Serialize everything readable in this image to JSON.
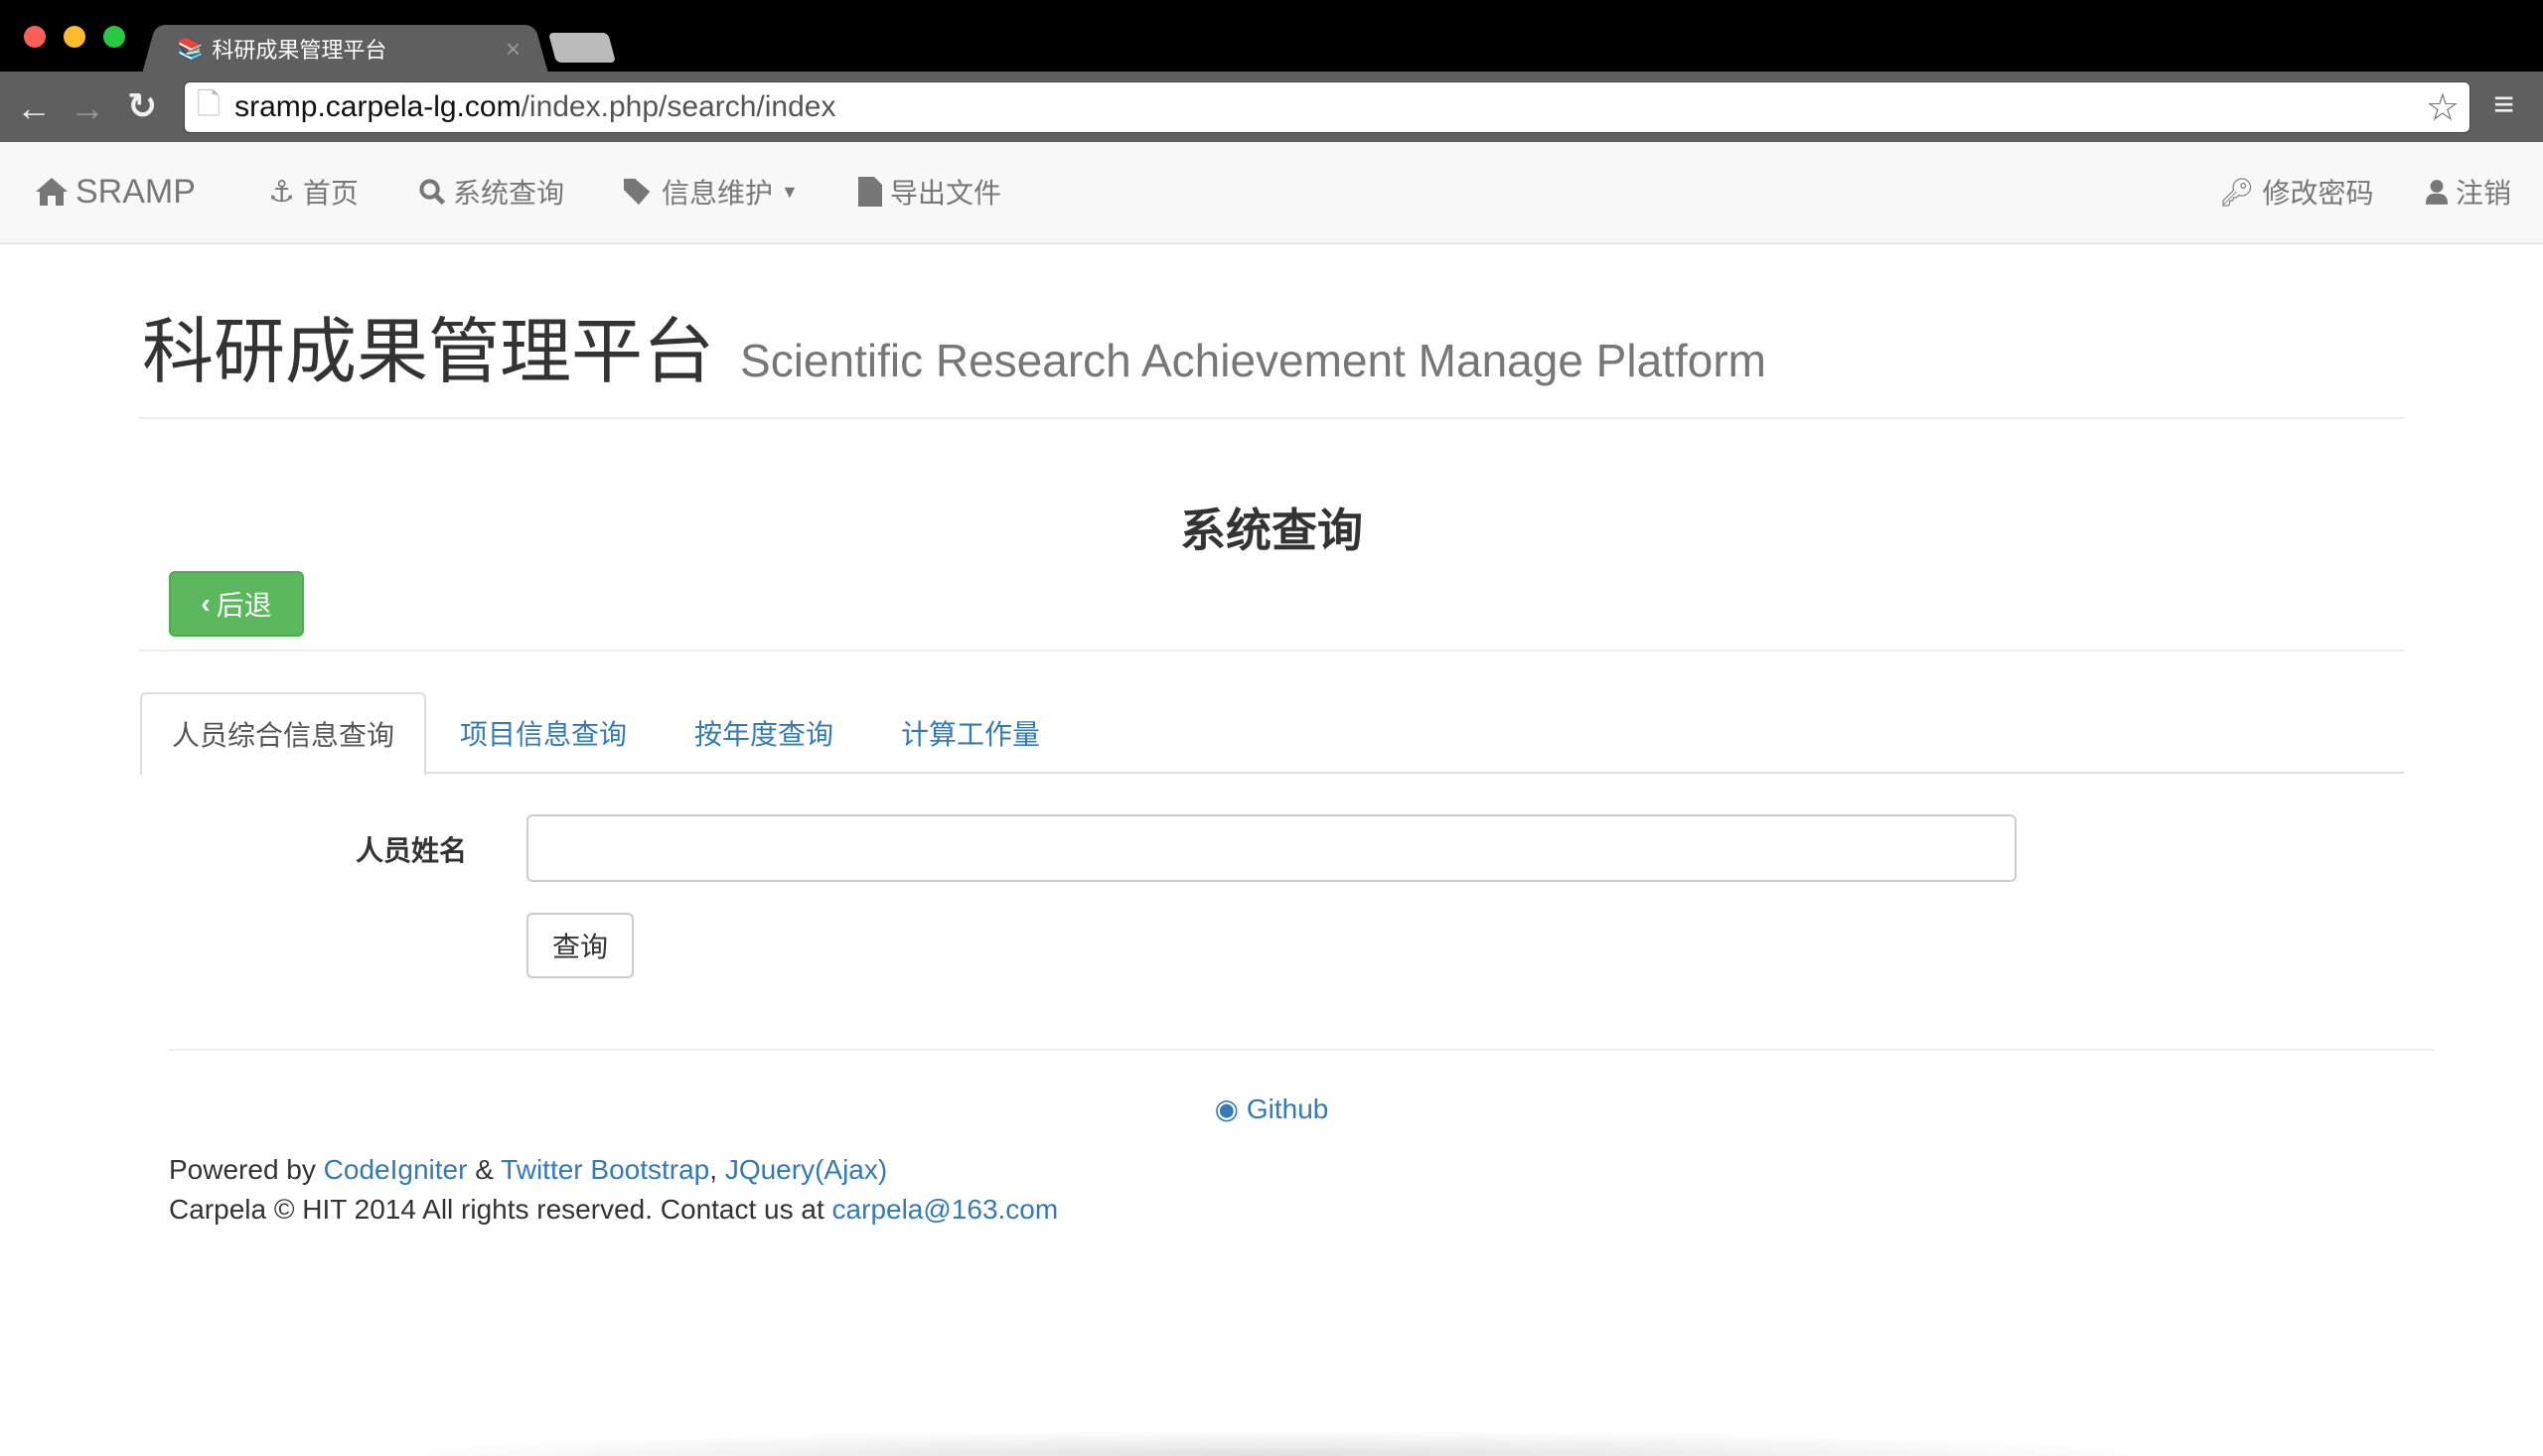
{
  "browser": {
    "tab_title": "科研成果管理平台",
    "url_domain": "sramp.carpela-lg.com",
    "url_path": "/index.php/search/index"
  },
  "navbar": {
    "brand": "SRAMP",
    "items": [
      {
        "label": "首页"
      },
      {
        "label": "系统查询"
      },
      {
        "label": "信息维护"
      },
      {
        "label": "导出文件"
      }
    ],
    "right": [
      {
        "label": "修改密码"
      },
      {
        "label": "注销"
      }
    ]
  },
  "header": {
    "title": "科研成果管理平台",
    "subtitle": "Scientific Research Achievement Manage Platform"
  },
  "page": {
    "heading": "系统查询",
    "back_label": "后退"
  },
  "tabs": [
    {
      "label": "人员综合信息查询"
    },
    {
      "label": "项目信息查询"
    },
    {
      "label": "按年度查询"
    },
    {
      "label": "计算工作量"
    }
  ],
  "form": {
    "name_label": "人员姓名",
    "name_value": "",
    "submit_label": "查询"
  },
  "footer": {
    "github": "Github",
    "powered_by": "Powered by",
    "codeigniter": "CodeIgniter",
    "amp": "&",
    "bootstrap": "Twitter Bootstrap",
    "comma": ",",
    "jquery": "JQuery(Ajax)",
    "copyright": "Carpela © HIT 2014 All rights reserved. Contact us at",
    "email": "carpela@163.com"
  }
}
